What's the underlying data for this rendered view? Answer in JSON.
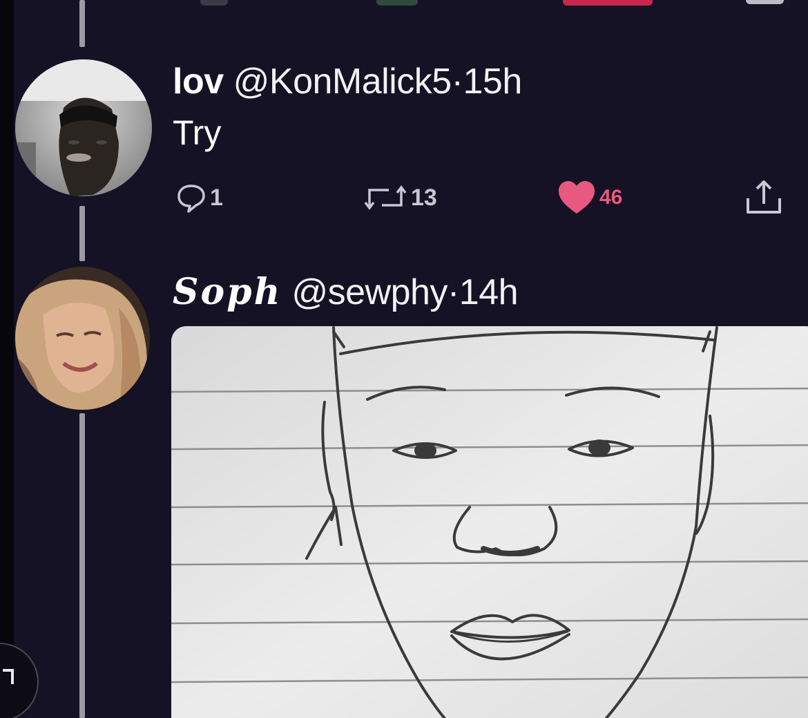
{
  "tweets": [
    {
      "display_name": "lov",
      "handle": "@KonMalick5",
      "separator": "·",
      "time": "15h",
      "text": "Try",
      "actions": {
        "reply_count": "1",
        "retweet_count": "13",
        "like_count": "46"
      }
    },
    {
      "display_name": "Soph",
      "handle": "@sewphy",
      "separator": "·",
      "time": "14h"
    }
  ],
  "colors": {
    "background": "#151225",
    "like": "#e8587f",
    "action": "#c9c7d1",
    "thread_line": "#9d9aa6"
  },
  "icons": {
    "reply": "speech-bubble-icon",
    "retweet": "retweet-icon",
    "like": "heart-icon",
    "share": "share-icon",
    "corner": "corner-arrow-icon"
  }
}
